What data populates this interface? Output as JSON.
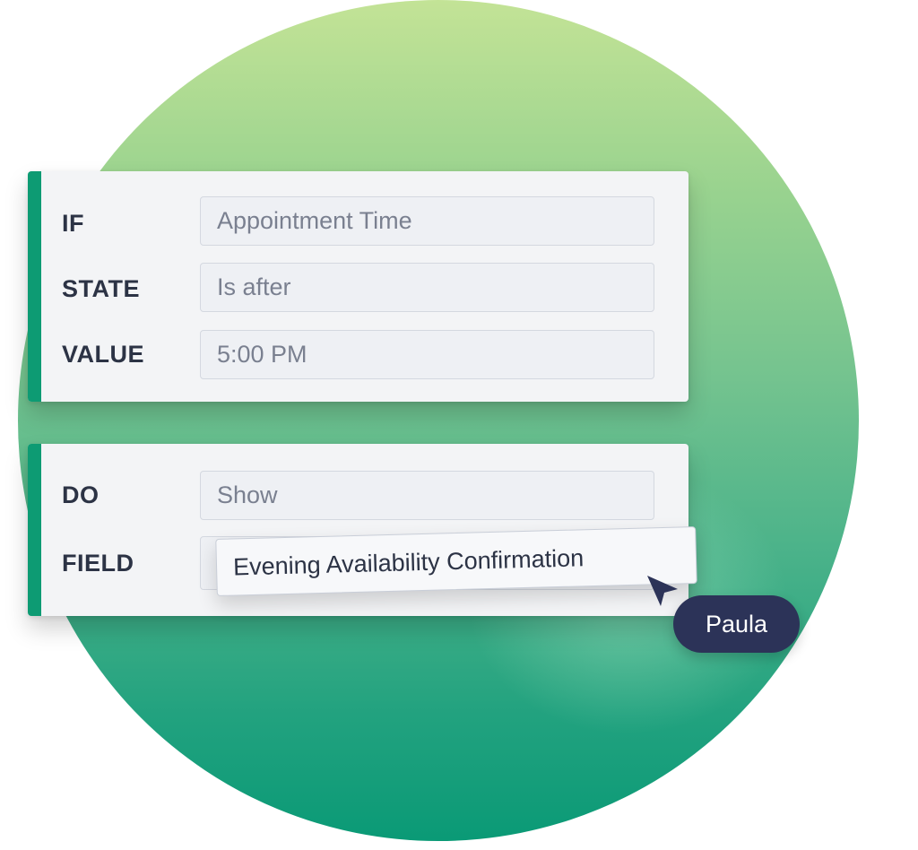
{
  "condition": {
    "if_label": "IF",
    "if_value": "Appointment Time",
    "state_label": "STATE",
    "state_value": "Is after",
    "value_label": "VALUE",
    "value_value": "5:00 PM"
  },
  "action": {
    "do_label": "DO",
    "do_value": "Show",
    "field_label": "FIELD",
    "field_value": "Evening Availability Confirmation"
  },
  "collaborator": {
    "name": "Paula"
  },
  "colors": {
    "accent": "#0d9b73",
    "label": "#2c3345",
    "pill": "#2c3358"
  },
  "icons": {
    "cursor": "cursor-arrow-icon"
  }
}
